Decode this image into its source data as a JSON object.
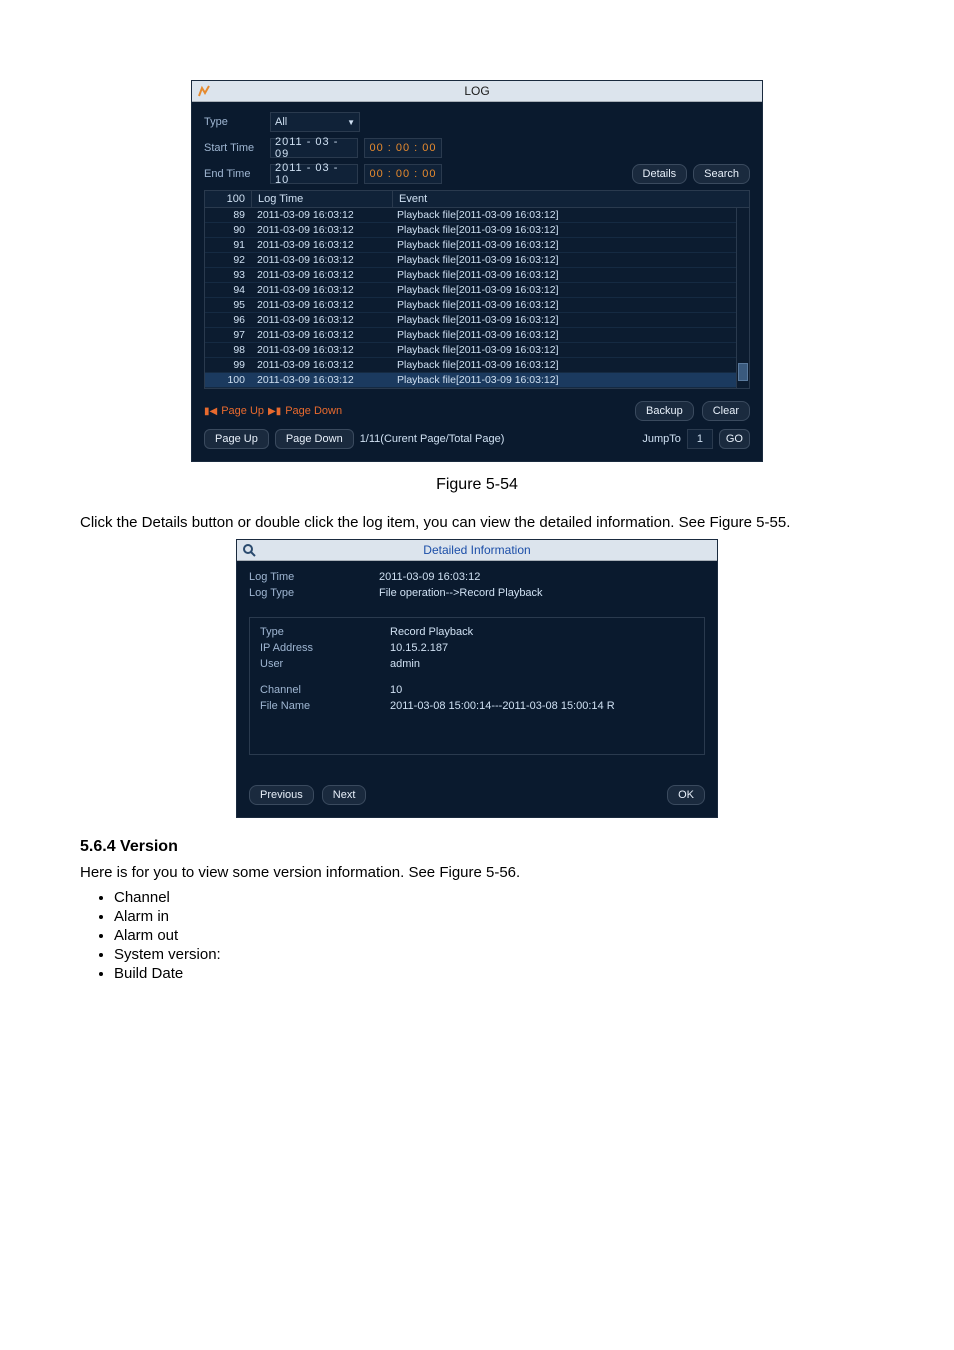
{
  "log": {
    "title": "LOG",
    "type_label": "Type",
    "type_value": "All",
    "start_label": "Start Time",
    "start_date": "2011 - 03 - 09",
    "start_time": "00 : 00 : 00",
    "end_label": "End Time",
    "end_date": "2011 - 03 - 10",
    "end_time": "00 : 00 : 00",
    "details_btn": "Details",
    "search_btn": "Search",
    "header_idx": "100",
    "header_time": "Log Time",
    "header_event": "Event",
    "rows": [
      {
        "idx": "89",
        "time": "2011-03-09 16:03:12",
        "event": "Playback file[2011-03-09 16:03:12]"
      },
      {
        "idx": "90",
        "time": "2011-03-09 16:03:12",
        "event": "Playback file[2011-03-09 16:03:12]"
      },
      {
        "idx": "91",
        "time": "2011-03-09 16:03:12",
        "event": "Playback file[2011-03-09 16:03:12]"
      },
      {
        "idx": "92",
        "time": "2011-03-09 16:03:12",
        "event": "Playback file[2011-03-09 16:03:12]"
      },
      {
        "idx": "93",
        "time": "2011-03-09 16:03:12",
        "event": "Playback file[2011-03-09 16:03:12]"
      },
      {
        "idx": "94",
        "time": "2011-03-09 16:03:12",
        "event": "Playback file[2011-03-09 16:03:12]"
      },
      {
        "idx": "95",
        "time": "2011-03-09 16:03:12",
        "event": "Playback file[2011-03-09 16:03:12]"
      },
      {
        "idx": "96",
        "time": "2011-03-09 16:03:12",
        "event": "Playback file[2011-03-09 16:03:12]"
      },
      {
        "idx": "97",
        "time": "2011-03-09 16:03:12",
        "event": "Playback file[2011-03-09 16:03:12]"
      },
      {
        "idx": "98",
        "time": "2011-03-09 16:03:12",
        "event": "Playback file[2011-03-09 16:03:12]"
      },
      {
        "idx": "99",
        "time": "2011-03-09 16:03:12",
        "event": "Playback file[2011-03-09 16:03:12]"
      },
      {
        "idx": "100",
        "time": "2011-03-09 16:03:12",
        "event": "Playback file[2011-03-09 16:03:12]"
      }
    ],
    "selected_idx": "100",
    "pgup": "Page Up",
    "pgdn": "Page Down",
    "backup_btn": "Backup",
    "clear_btn": "Clear",
    "pgup_btn": "Page Up",
    "pgdn_btn": "Page Down",
    "page_info": "1/11(Curent Page/Total Page)",
    "jump_label": "JumpTo",
    "jump_value": "1",
    "go_btn": "GO"
  },
  "caption1": "Figure 5-54",
  "para1": "Click the Details button or double click the log item, you can view the detailed information. See Figure 5-55.",
  "detail": {
    "title": "Detailed Information",
    "logtime_label": "Log Time",
    "logtime_val": "2011-03-09 16:03:12",
    "logtype_label": "Log Type",
    "logtype_val": "File operation-->Record Playback",
    "type_label": "Type",
    "type_val": "Record Playback",
    "ip_label": "IP Address",
    "ip_val": "10.15.2.187",
    "user_label": "User",
    "user_val": "admin",
    "channel_label": "Channel",
    "channel_val": "10",
    "file_label": "File Name",
    "file_val": "2011-03-08 15:00:14---2011-03-08 15:00:14 R",
    "prev_btn": "Previous",
    "next_btn": "Next",
    "ok_btn": "OK"
  },
  "version_heading": "5.6.4  Version",
  "version_para": "Here is for you to view some version information. See Figure 5-56.",
  "bullets": [
    "Channel",
    "Alarm in",
    "Alarm out",
    "System version:",
    "Build Date"
  ]
}
